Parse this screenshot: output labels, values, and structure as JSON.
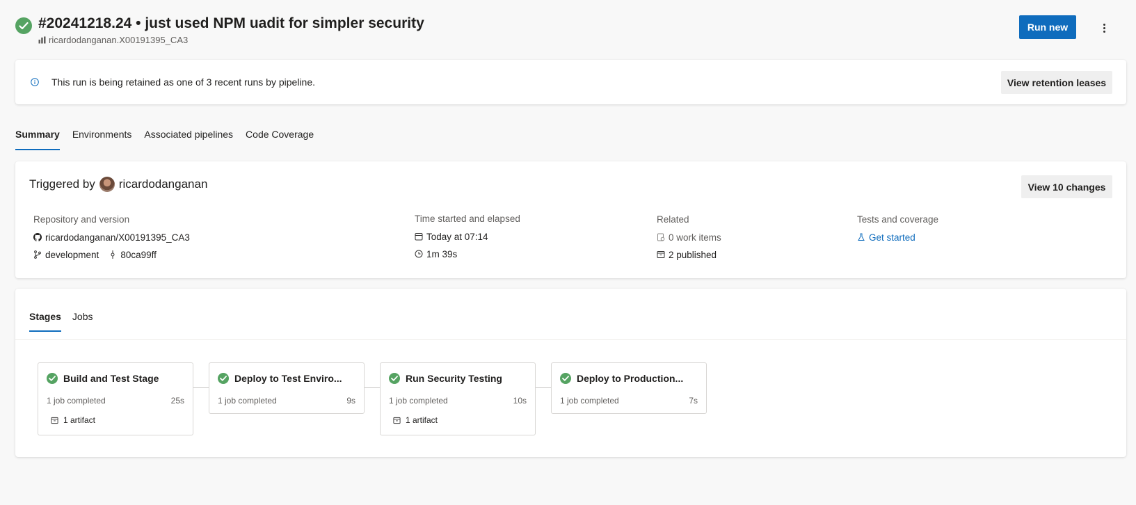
{
  "header": {
    "title": "#20241218.24 • just used NPM uadit for simpler security",
    "repo": "ricardodanganan.X00191395_CA3",
    "run_new_label": "Run new",
    "more_label": "⋮"
  },
  "retention": {
    "message": "This run is being retained as one of 3 recent runs by pipeline.",
    "button_label": "View retention leases"
  },
  "tabs": [
    {
      "label": "Summary",
      "active": true
    },
    {
      "label": "Environments"
    },
    {
      "label": "Associated pipelines"
    },
    {
      "label": "Code Coverage"
    }
  ],
  "summary": {
    "triggered_prefix": "Triggered by",
    "triggered_user": "ricardodanganan",
    "changes_button": "View 10 changes",
    "repository": {
      "label": "Repository and version",
      "repo": "ricardodanganan/X00191395_CA3",
      "branch": "development",
      "commit": "80ca99ff"
    },
    "time": {
      "label": "Time started and elapsed",
      "started": "Today at 07:14",
      "elapsed": "1m 39s"
    },
    "related": {
      "label": "Related",
      "work_items": "0 work items",
      "published": "2 published"
    },
    "tests": {
      "label": "Tests and coverage",
      "link": "Get started"
    }
  },
  "stages_tabs": [
    {
      "label": "Stages",
      "active": true
    },
    {
      "label": "Jobs"
    }
  ],
  "stages": [
    {
      "name": "Build and Test Stage",
      "jobs": "1 job completed",
      "time": "25s",
      "artifact": "1 artifact"
    },
    {
      "name": "Deploy to Test Enviro...",
      "jobs": "1 job completed",
      "time": "9s"
    },
    {
      "name": "Run Security Testing",
      "jobs": "1 job completed",
      "time": "10s",
      "artifact": "1 artifact"
    },
    {
      "name": "Deploy to Production...",
      "jobs": "1 job completed",
      "time": "7s"
    }
  ],
  "colors": {
    "accent": "#0f6cbd",
    "success": "#55a362",
    "background": "#f8f8f8"
  }
}
